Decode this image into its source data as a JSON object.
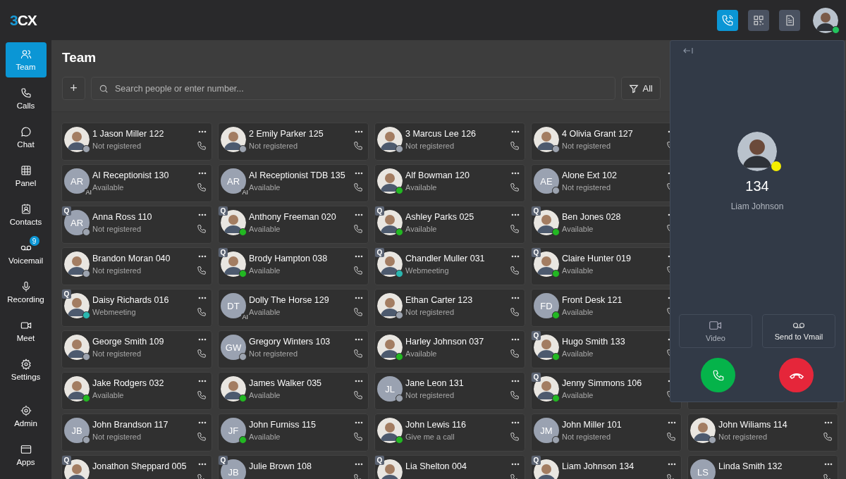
{
  "logo": {
    "accent": "3",
    "rest": "CX"
  },
  "topbar": {
    "buttons": [
      {
        "selected": true
      },
      {
        "selected": false
      },
      {
        "selected": false
      }
    ],
    "user": {
      "color": "#22c55e"
    }
  },
  "sidebar": {
    "items": [
      {
        "label": "Team",
        "selected": true
      },
      {
        "label": "Calls",
        "selected": false
      },
      {
        "label": "Chat",
        "selected": false
      },
      {
        "label": "Panel",
        "selected": false
      },
      {
        "label": "Contacts",
        "selected": false
      },
      {
        "label": "Voicemail",
        "selected": false,
        "badge": "9"
      },
      {
        "label": "Recording",
        "selected": false
      },
      {
        "label": "Meet",
        "selected": false
      },
      {
        "label": "Settings",
        "selected": false
      }
    ],
    "bottom_items": [
      {
        "label": "Admin",
        "selected": false
      },
      {
        "label": "Apps",
        "selected": false
      }
    ]
  },
  "page": {
    "title": "Team",
    "add_button": "+",
    "search": {
      "placeholder": "Search people or enter number..."
    },
    "filter": "All"
  },
  "rows": [
    {
      "cards": [
        {
          "name": "1 Jason Miller 122",
          "status": "Not registered",
          "kind": "photo",
          "color": "#9ca3af"
        },
        {
          "name": "2 Emily Parker 125",
          "status": "Not registered",
          "kind": "photo",
          "color": "#9ca3af"
        },
        {
          "name": "3 Marcus Lee 126",
          "status": "Not registered",
          "kind": "photo",
          "color": "#9ca3af"
        },
        {
          "name": "4 Olivia Grant 127",
          "status": "Not registered",
          "kind": "photo",
          "color": "#9ca3af"
        }
      ]
    },
    {
      "cards": [
        {
          "name": "AI Receptionist 130",
          "status": "Available",
          "kind": "initials",
          "initials": "AR",
          "ai_badge": "AI"
        },
        {
          "name": "AI Receptionist TDB 135",
          "status": "Available",
          "kind": "initials",
          "initials": "AR",
          "ai_badge": "AI"
        },
        {
          "name": "Alf Bowman 120",
          "status": "Available",
          "kind": "photo",
          "color": "#22b822"
        },
        {
          "name": "Alone Ext 102",
          "status": "Not registered",
          "kind": "initials",
          "initials": "AE",
          "color": "#9ca3af"
        }
      ]
    },
    {
      "cards": [
        {
          "name": "Anna Ross 110",
          "status": "Not registered",
          "kind": "initials",
          "initials": "AR",
          "color": "#9ca3af",
          "queue_badge": "Q"
        },
        {
          "name": "Anthony Freeman 020",
          "status": "Available",
          "kind": "photo",
          "color": "#22b822",
          "queue_badge": "Q"
        },
        {
          "name": "Ashley Parks 025",
          "status": "Available",
          "kind": "photo",
          "color": "#22b822",
          "queue_badge": "Q"
        },
        {
          "name": "Ben Jones 028",
          "status": "Available",
          "kind": "photo",
          "color": "#22b822",
          "queue_badge": "Q"
        }
      ]
    },
    {
      "cards": [
        {
          "name": "Brandon Moran 040",
          "status": "Not registered",
          "kind": "photo",
          "color": "#9ca3af"
        },
        {
          "name": "Brody Hampton 038",
          "status": "Available",
          "kind": "photo",
          "color": "#22b822",
          "queue_badge": "Q"
        },
        {
          "name": "Chandler Muller 031",
          "status": "Webmeeting",
          "kind": "photo",
          "color": "#2ab7b0",
          "queue_badge": "Q"
        },
        {
          "name": "Claire Hunter 019",
          "status": "Available",
          "kind": "photo",
          "color": "#22b822",
          "queue_badge": "Q"
        }
      ]
    },
    {
      "cards": [
        {
          "name": "Daisy Richards 016",
          "status": "Webmeeting",
          "kind": "photo",
          "color": "#2ab7b0",
          "queue_badge": "Q"
        },
        {
          "name": "Dolly The Horse 129",
          "status": "Available",
          "kind": "initials",
          "initials": "DT",
          "ai_badge": "AI"
        },
        {
          "name": "Ethan Carter 123",
          "status": "Not registered",
          "kind": "photo",
          "color": "#9ca3af"
        },
        {
          "name": "Front Desk 121",
          "status": "Available",
          "kind": "initials",
          "initials": "FD",
          "color": "#22b822"
        }
      ]
    },
    {
      "cards": [
        {
          "name": "George Smith 109",
          "status": "Not registered",
          "kind": "photo",
          "color": "#9ca3af"
        },
        {
          "name": "Gregory Winters 103",
          "status": "Not registered",
          "kind": "initials",
          "initials": "GW",
          "color": "#9ca3af"
        },
        {
          "name": "Harley Johnson 037",
          "status": "Available",
          "kind": "photo",
          "color": "#22b822"
        },
        {
          "name": "Hugo Smith 133",
          "status": "Available",
          "kind": "photo",
          "color": "#22b822",
          "queue_badge": "Q"
        }
      ]
    },
    {
      "cards": [
        {
          "name": "Jake Rodgers 032",
          "status": "Available",
          "kind": "photo",
          "color": "#22b822"
        },
        {
          "name": "James Walker 035",
          "status": "Available",
          "kind": "photo",
          "color": "#22b822"
        },
        {
          "name": "Jane Leon 131",
          "status": "Not registered",
          "kind": "initials",
          "initials": "JL",
          "color": "#9ca3af"
        },
        {
          "name": "Jenny Simmons 106",
          "status": "Available",
          "kind": "photo",
          "color": "#22b822",
          "queue_badge": "Q"
        }
      ]
    },
    {
      "cards": [
        {
          "name": "John Brandson 117",
          "status": "Not registered",
          "kind": "initials",
          "initials": "JB",
          "color": "#9ca3af"
        },
        {
          "name": "John Furniss 115",
          "status": "Available",
          "kind": "initials",
          "initials": "JF",
          "color": "#22b822"
        },
        {
          "name": "John Lewis 116",
          "status": "Give me a call",
          "kind": "photo",
          "color": "#22b822"
        },
        {
          "name": "John Miller 101",
          "status": "Not registered",
          "kind": "initials",
          "initials": "JM",
          "color": "#9ca3af"
        },
        {
          "name": "John Wiliams 114",
          "status": "Not registered",
          "kind": "photo",
          "color": "#9ca3af"
        }
      ]
    },
    {
      "cards": [
        {
          "name": "Jonathon Sheppard 005",
          "kind": "photo",
          "queue_badge": "Q"
        },
        {
          "name": "Julie Brown 108",
          "kind": "initials",
          "initials": "JB",
          "queue_badge": "Q"
        },
        {
          "name": "Lia Shelton 004",
          "kind": "photo",
          "queue_badge": "Q"
        },
        {
          "name": "Liam Johnson 134",
          "kind": "photo",
          "queue_badge": "Q"
        },
        {
          "name": "Linda Smith 132",
          "kind": "initials",
          "initials": "LS"
        }
      ]
    }
  ],
  "call_panel": {
    "color": "#f5ee00",
    "number": "134",
    "caller": "Liam Johnson",
    "actions": [
      "Video",
      "Send to Vmail"
    ]
  }
}
